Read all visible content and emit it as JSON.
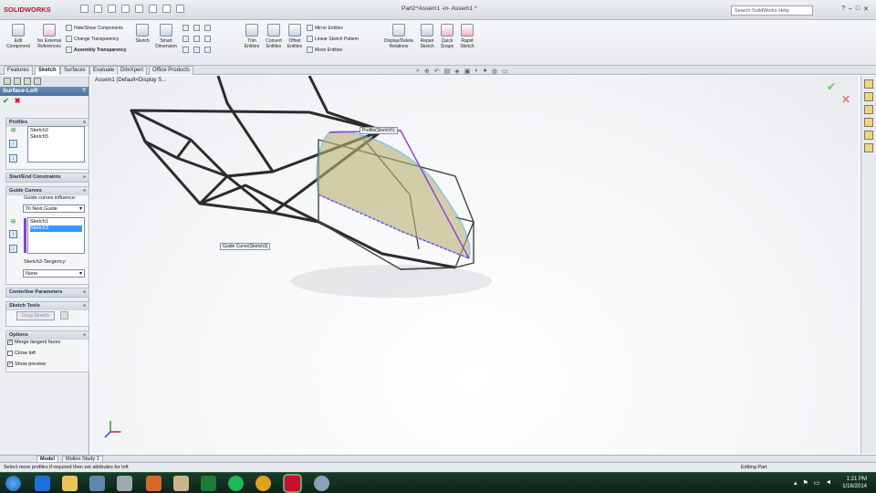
{
  "app": {
    "brand": "SOLIDWORKS",
    "doc_title": "Part2^Assem1 -in- Assem1 *",
    "search_placeholder": "Search SolidWorks Help"
  },
  "ribbon": {
    "edit_component": "Edit Component",
    "no_external": "No External References",
    "hide_show": "Hide/Show Components",
    "change_transparency": "Change Transparency",
    "assembly_transparency": "Assembly Transparency",
    "sketch": "Sketch",
    "smart_dimension": "Smart Dimension",
    "trim": "Trim Entities",
    "convert": "Convert Entities",
    "offset": "Offset Entities",
    "mirror": "Mirror Entities",
    "linear_pattern": "Linear Sketch Pattern",
    "move": "Move Entities",
    "display_delete": "Display/Delete Relations",
    "repair": "Repair Sketch",
    "quick_snaps": "Quick Snaps",
    "rapid_sketch": "Rapid Sketch"
  },
  "tabs": [
    "Features",
    "Sketch",
    "Surfaces",
    "Evaluate",
    "DimXpert",
    "Office Products"
  ],
  "panel": {
    "title": "Surface-Loft",
    "help": "?",
    "ok": "✔",
    "cancel": "✖",
    "profiles": {
      "header": "Profiles",
      "items": [
        "Sketch2",
        "Sketch5"
      ]
    },
    "start_end": {
      "header": "Start/End Constraints"
    },
    "guide": {
      "header": "Guide Curves",
      "influence_label": "Guide curves influence:",
      "influence_value": "To Next Guide",
      "items": [
        "Sketch1",
        "Sketch3"
      ],
      "tangency_label": "Sketch3-Tangency:",
      "tangency_value": "None"
    },
    "centerline": {
      "header": "Centerline Parameters"
    },
    "sketch_tools": {
      "header": "Sketch Tools",
      "drag_sketch": "Drag Sketch"
    },
    "options": {
      "header": "Options",
      "merge": "Merge tangent faces",
      "close": "Close loft",
      "preview": "Show preview"
    }
  },
  "viewport": {
    "tree": "Assem1 (Default<Display S...",
    "callout_profile": "Profile(Sketch5)",
    "callout_guide": "Guide Curve(Sketch3)"
  },
  "bottom_tabs": [
    "Model",
    "Motion Study 1"
  ],
  "status": {
    "hint": "Select more profiles if required then set attributes for loft",
    "editing": "Editing Part"
  },
  "taskbar": {
    "time": "1:21 PM",
    "date": "1/16/2014"
  },
  "colors": {
    "accent": "#c8102e",
    "panel_title": "#4a6f9e",
    "selection": "#3399ff",
    "taskbar": "#0e2318"
  }
}
